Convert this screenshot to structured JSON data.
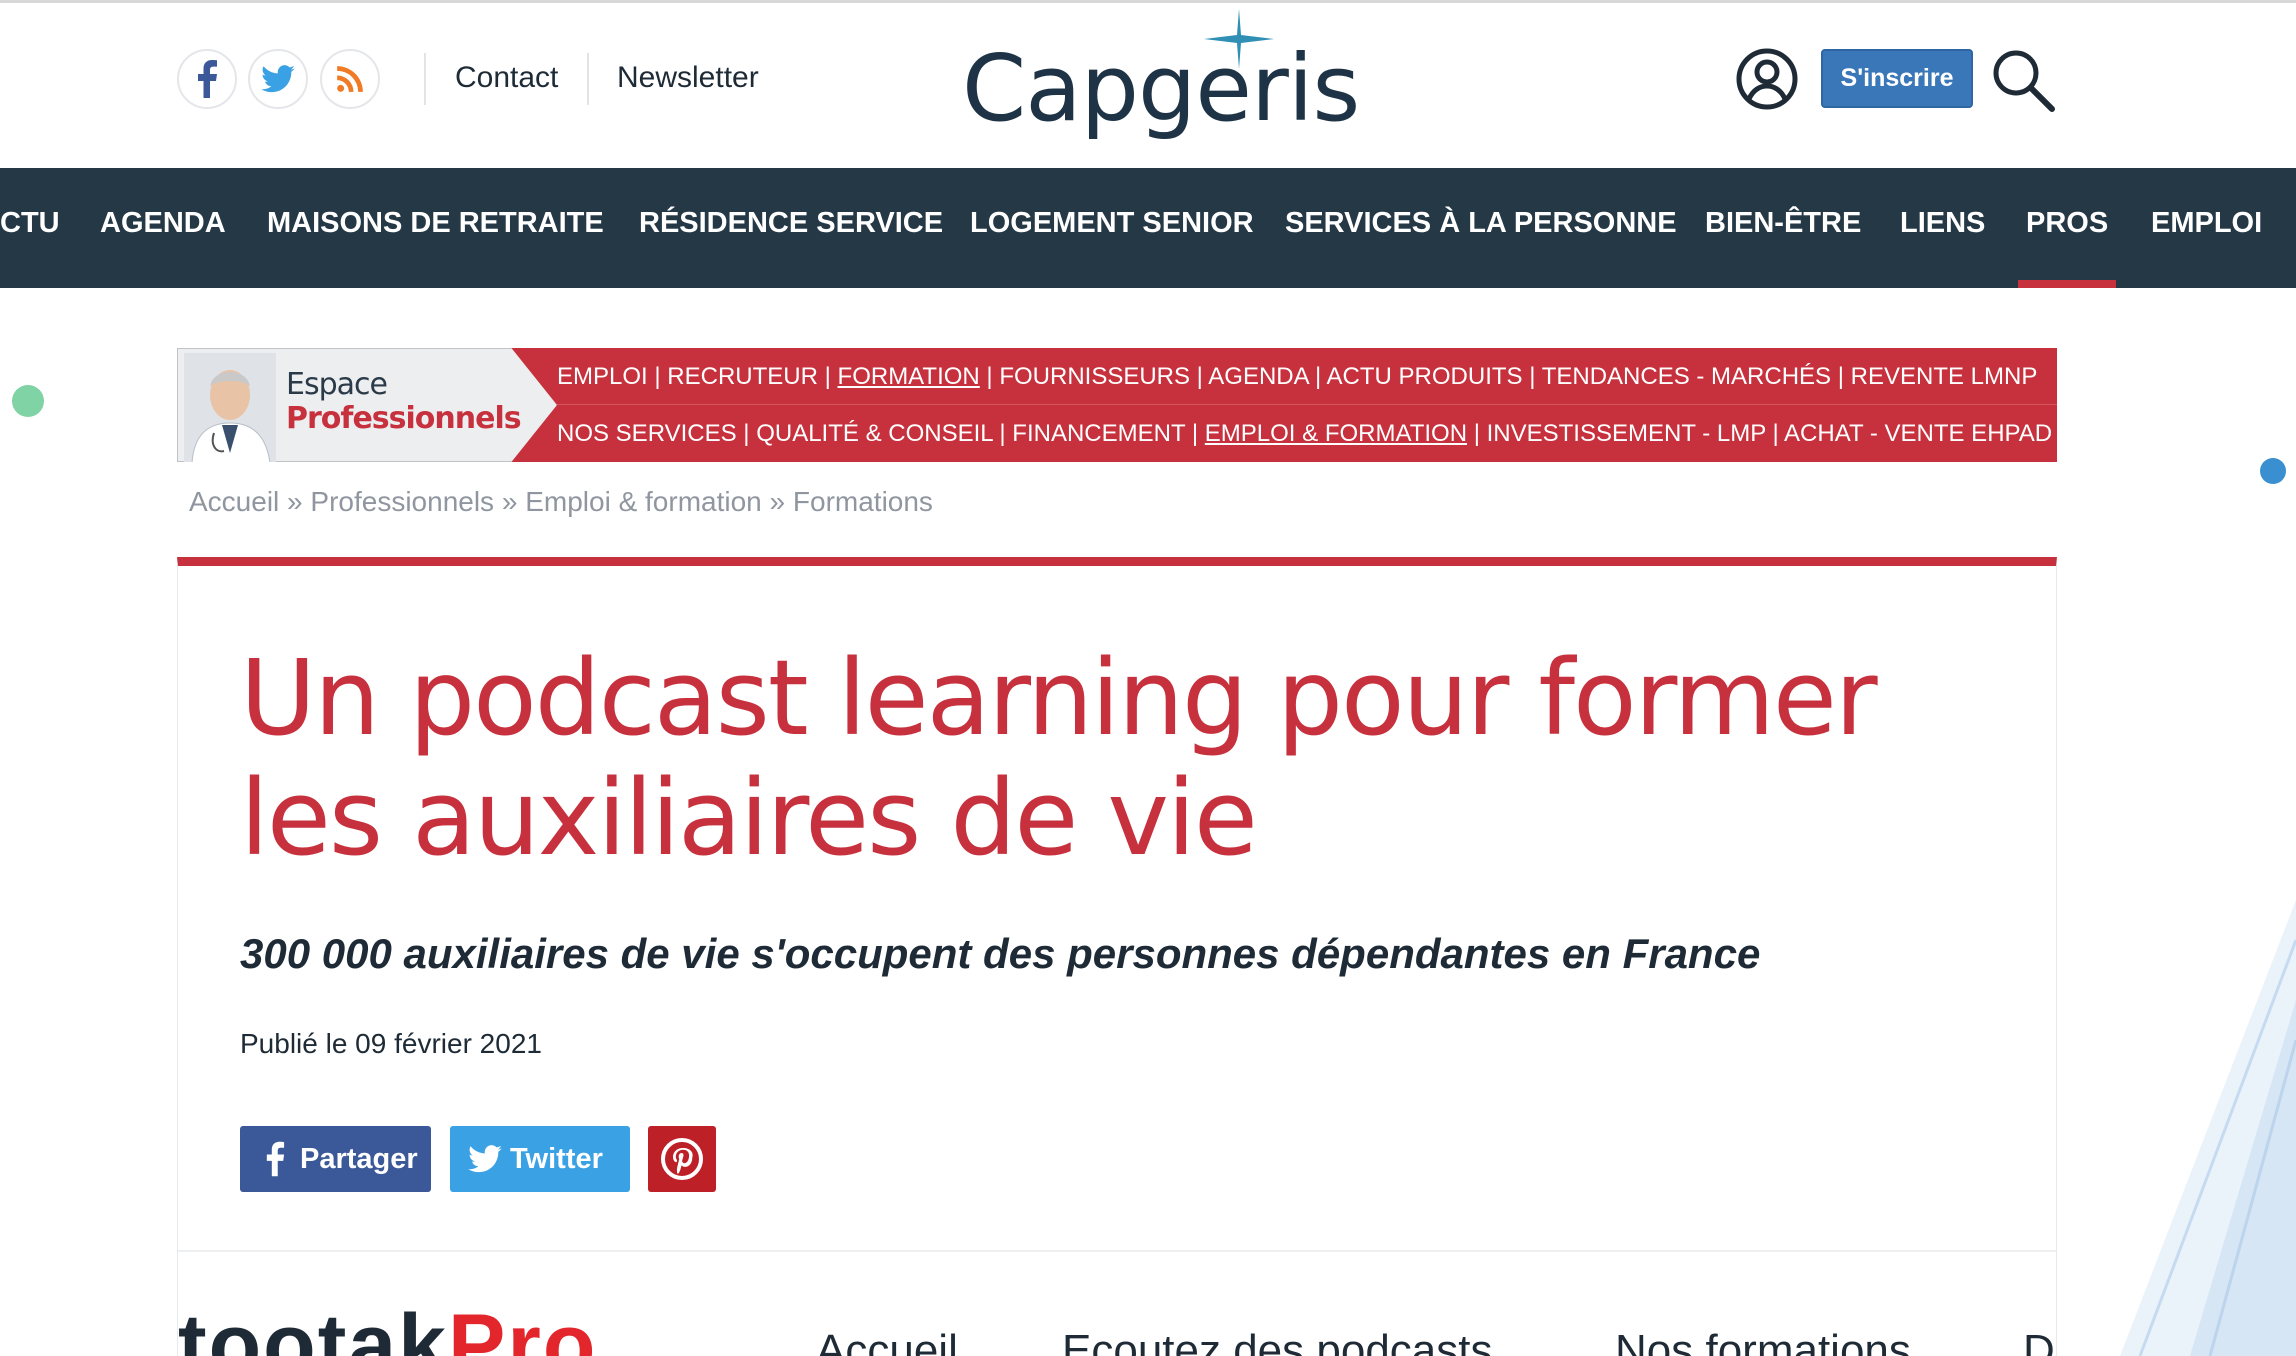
{
  "header": {
    "contact_label": "Contact",
    "newsletter_label": "Newsletter",
    "logo_text": "Capgeris",
    "register_label": "S'inscrire"
  },
  "nav": {
    "items": [
      {
        "label": "CTU",
        "active": false
      },
      {
        "label": "AGENDA",
        "active": false
      },
      {
        "label": "MAISONS DE RETRAITE",
        "active": false
      },
      {
        "label": "RÉSIDENCE SERVICE",
        "active": false
      },
      {
        "label": "LOGEMENT SENIOR",
        "active": false
      },
      {
        "label": "SERVICES À LA PERSONNE",
        "active": false
      },
      {
        "label": "BIEN-ÊTRE",
        "active": false
      },
      {
        "label": "LIENS",
        "active": false
      },
      {
        "label": "PROS",
        "active": true
      },
      {
        "label": "EMPLOI",
        "active": false
      }
    ]
  },
  "pros_banner": {
    "espace_line1": "Espace",
    "espace_line2": "Professionnels",
    "row1": [
      "EMPLOI",
      "RECRUTEUR",
      "FORMATION",
      "FOURNISSEURS",
      "AGENDA",
      "ACTU PRODUITS",
      "TENDANCES - MARCHÉS",
      "REVENTE LMNP"
    ],
    "row2": [
      "NOS SERVICES",
      "QUALITÉ & CONSEIL",
      "FINANCEMENT",
      "EMPLOI & FORMATION",
      "INVESTISSEMENT - LMP",
      "ACHAT - VENTE EHPAD"
    ]
  },
  "breadcrumb": {
    "items": [
      "Accueil",
      "Professionnels",
      "Emploi & formation",
      "Formations"
    ],
    "separator": "»"
  },
  "article": {
    "title": "Un podcast learning pour former les auxiliaires de vie",
    "subtitle": "300 000 auxiliaires de vie s'occupent des personnes dépendantes en France",
    "published": "Publié le 09 février 2021"
  },
  "share": {
    "facebook_label": "Partager",
    "twitter_label": "Twitter"
  },
  "embed": {
    "logo_part1": "tootak",
    "logo_part2": "Pro",
    "nav_items": [
      "Accueil",
      "Ecoutez des podcasts",
      "Nos formations",
      "D"
    ]
  },
  "colors": {
    "brand_red": "#c7313d",
    "nav_bg": "#243846",
    "register_blue": "#3a77b8",
    "facebook": "#3b5998",
    "twitter": "#3aa1e4",
    "pinterest": "#bd2026"
  }
}
